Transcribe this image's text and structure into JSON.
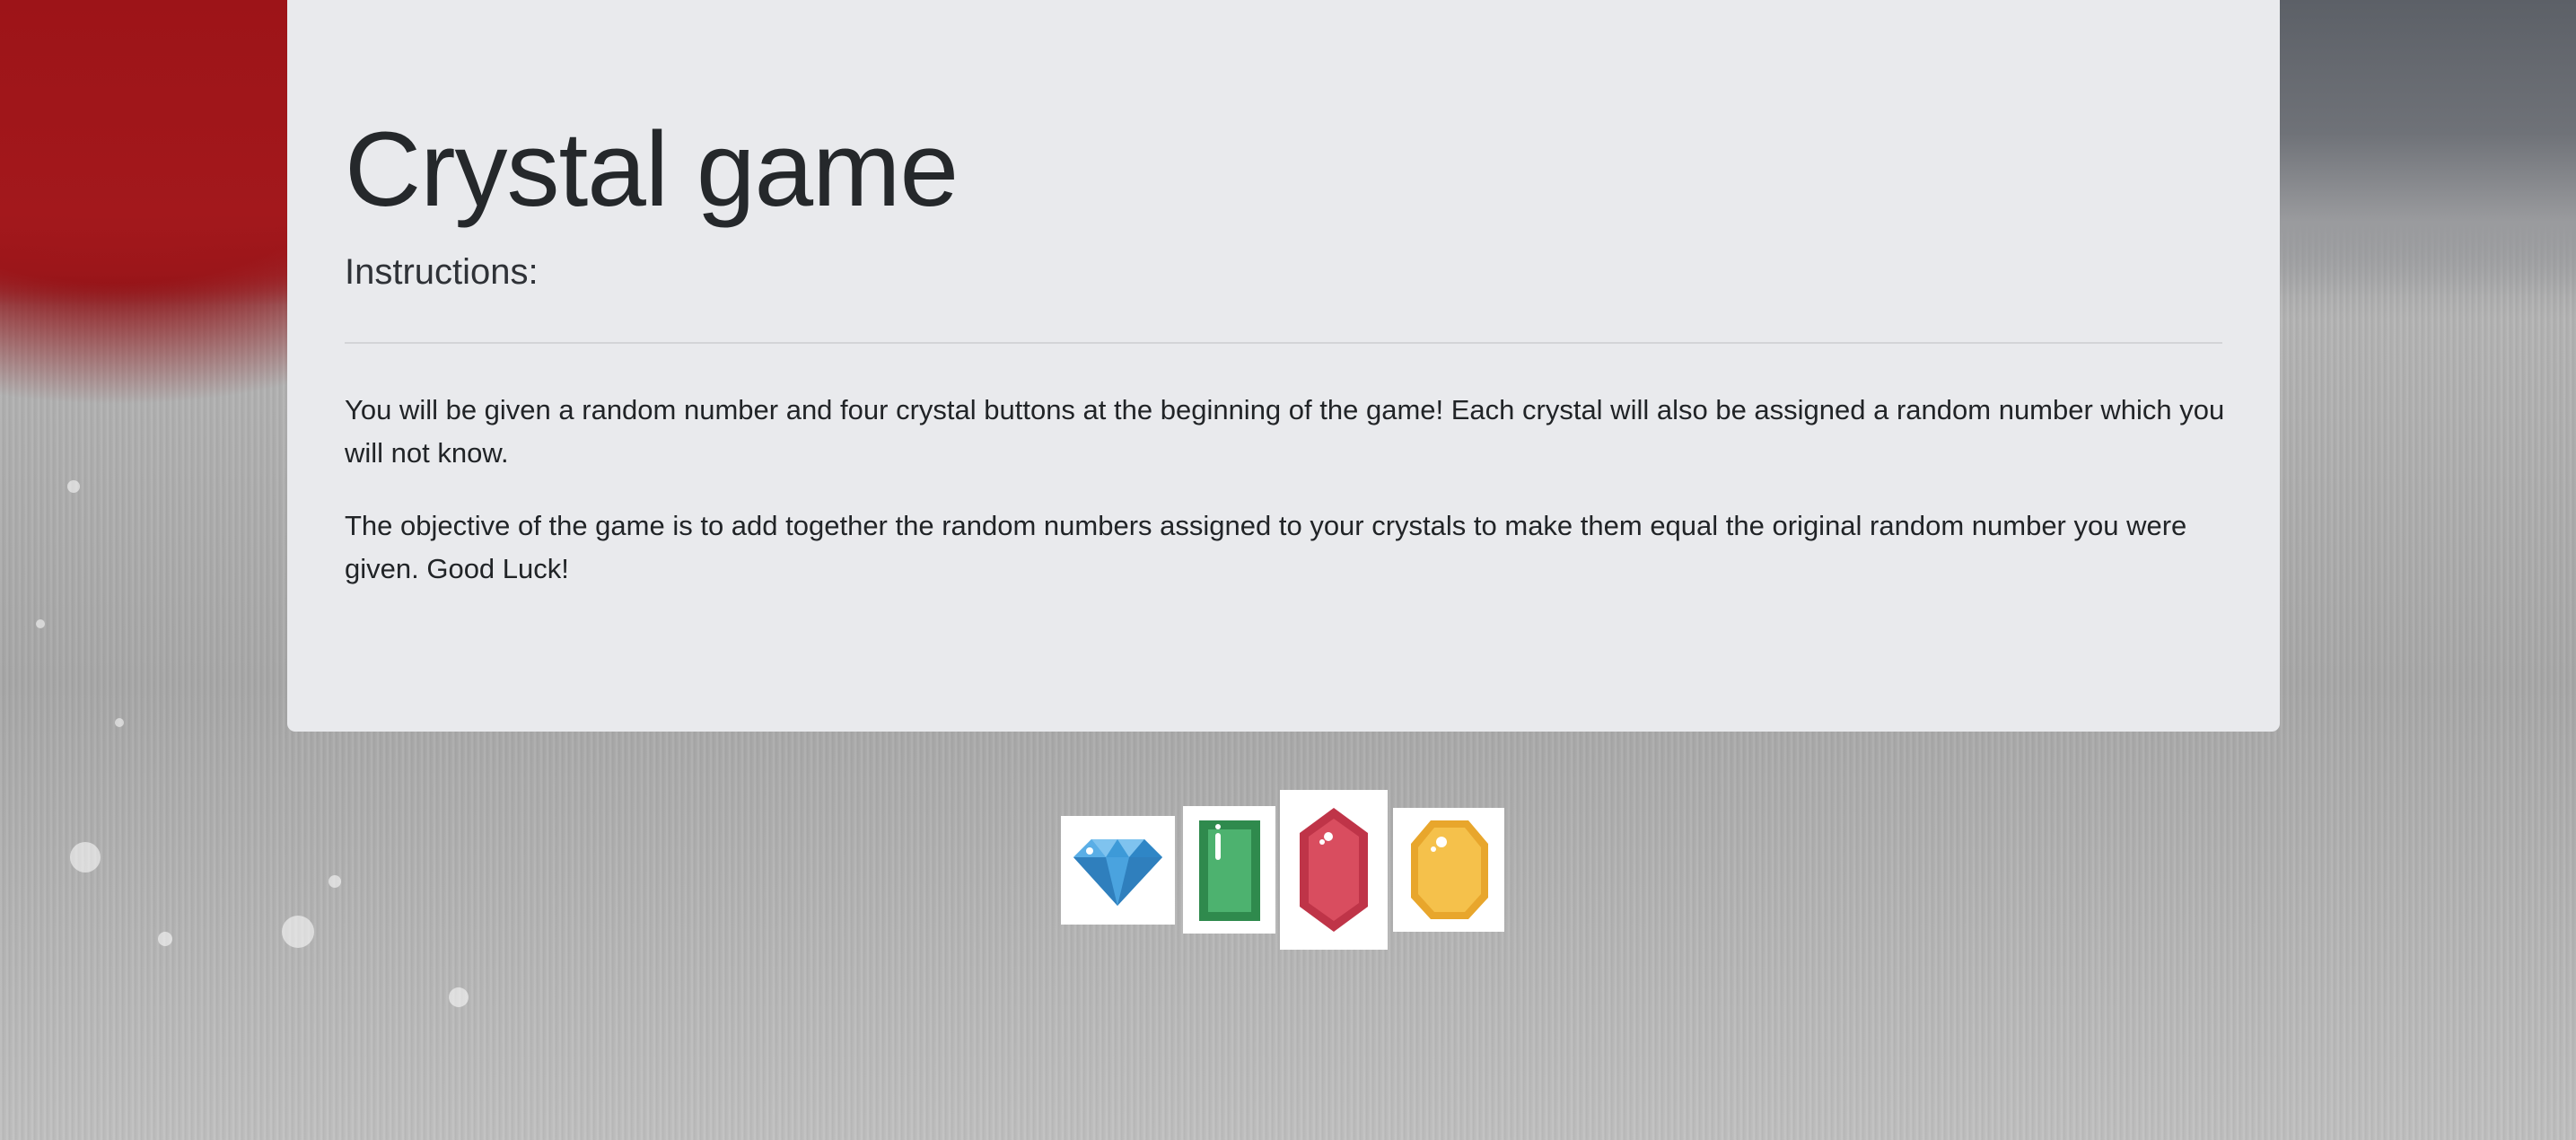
{
  "jumbotron": {
    "title": "Crystal game",
    "subtitle": "Instructions:",
    "paragraphs": [
      "You will be given a random number and four crystal buttons at the beginning of the game! Each crystal will also be assigned a random number which you will not know.",
      "The objective of the game is to add together the random numbers assigned to your crystals to make them equal the original random number you were given. Good Luck!"
    ]
  },
  "crystals": [
    {
      "icon": "blue-diamond-icon",
      "color": "#3d9ad8"
    },
    {
      "icon": "green-emerald-icon",
      "color": "#3fa260"
    },
    {
      "icon": "red-ruby-icon",
      "color": "#d9495b"
    },
    {
      "icon": "yellow-topaz-icon",
      "color": "#f5bf47"
    }
  ]
}
